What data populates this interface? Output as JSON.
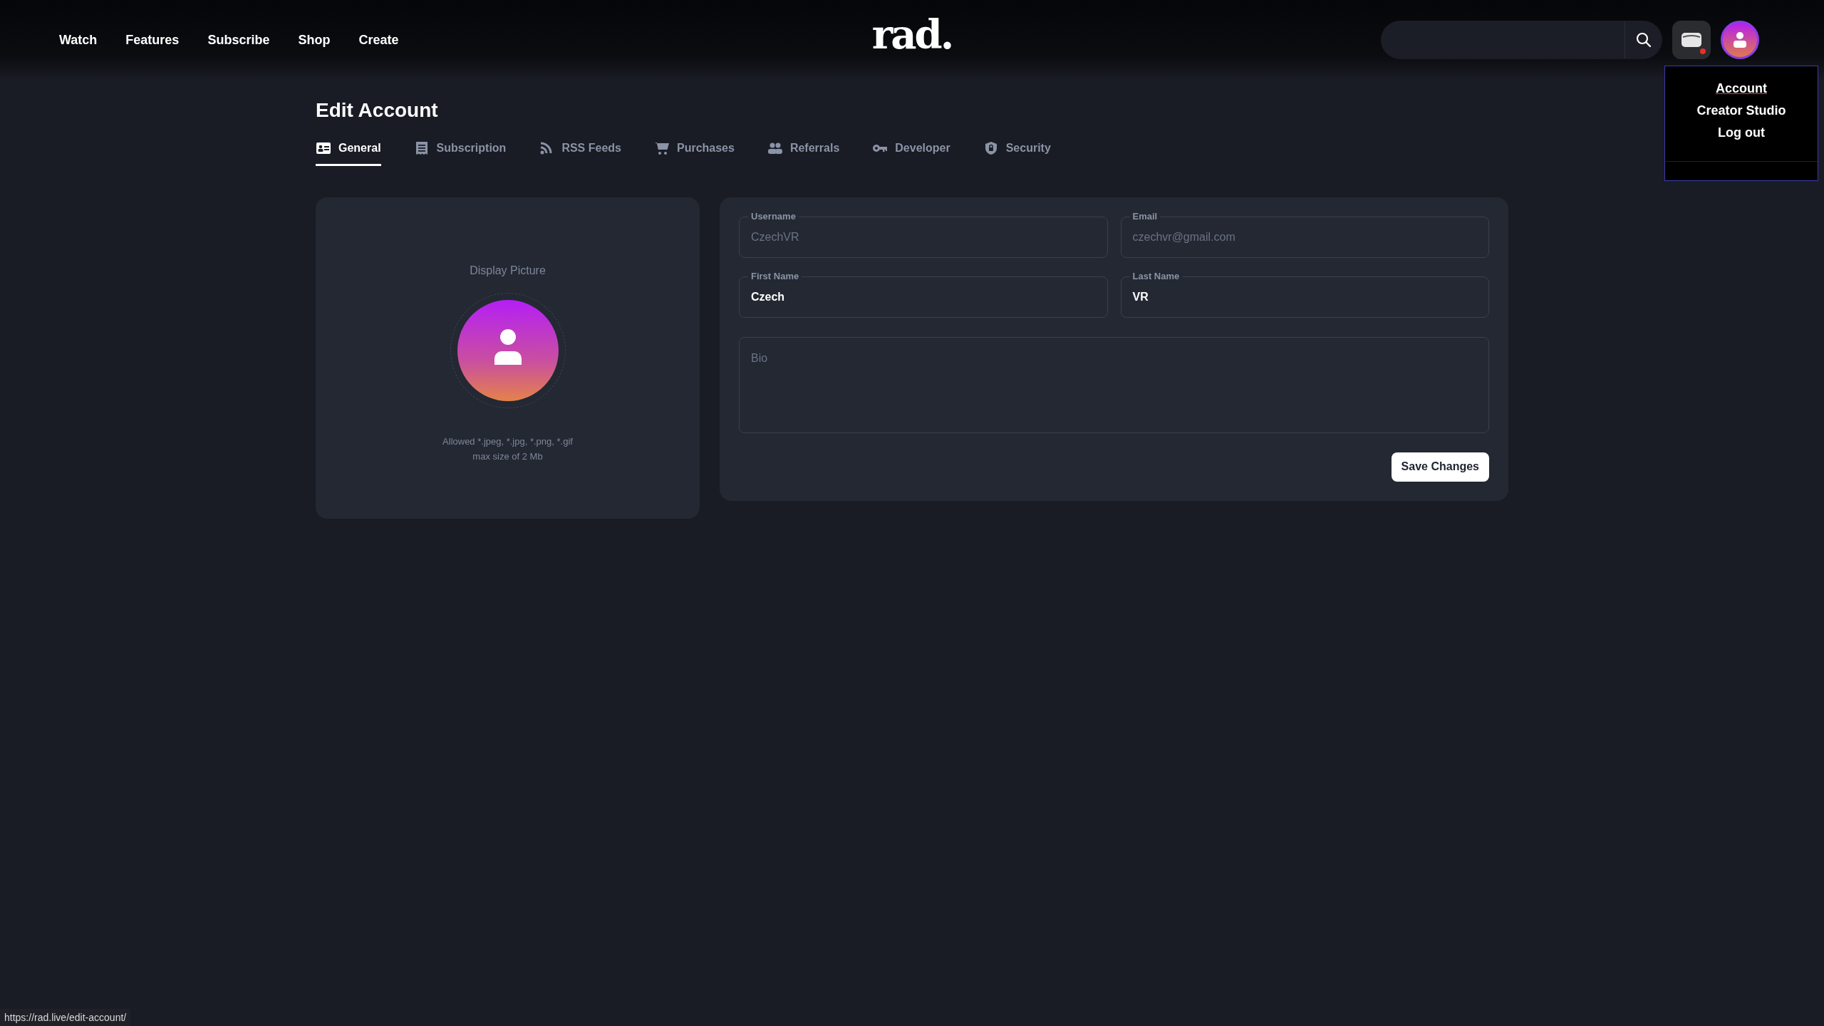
{
  "nav": {
    "links": [
      "Watch",
      "Features",
      "Subscribe",
      "Shop",
      "Create"
    ],
    "logo": "rad."
  },
  "header_actions": {
    "notification_dot": true
  },
  "account_menu": {
    "items": [
      {
        "label": "Account",
        "hovered": true
      },
      {
        "label": "Creator Studio",
        "hovered": false
      },
      {
        "label": "Log out",
        "hovered": false
      }
    ]
  },
  "page": {
    "title": "Edit Account"
  },
  "tabs": [
    {
      "label": "General",
      "kind": "idcard",
      "selected": true
    },
    {
      "label": "Subscription",
      "kind": "receipt",
      "selected": false
    },
    {
      "label": "RSS Feeds",
      "kind": "rss",
      "selected": false
    },
    {
      "label": "Purchases",
      "kind": "cart",
      "selected": false
    },
    {
      "label": "Referrals",
      "kind": "users",
      "selected": false
    },
    {
      "label": "Developer",
      "kind": "key",
      "selected": false
    },
    {
      "label": "Security",
      "kind": "shield",
      "selected": false
    }
  ],
  "display_picture": {
    "title": "Display Picture",
    "hint_lines": [
      "Allowed *.jpeg, *.jpg, *.png, *.gif",
      "max size of 2 Mb"
    ]
  },
  "form": {
    "fields": [
      {
        "label": "Username",
        "value": "CzechVR",
        "disabled": true
      },
      {
        "label": "Email",
        "value": "czechvr@gmail.com",
        "disabled": true
      },
      {
        "label": "First Name",
        "value": "Czech",
        "disabled": false
      },
      {
        "label": "Last Name",
        "value": "VR",
        "disabled": false
      }
    ],
    "bio": {
      "placeholder": "Bio"
    },
    "save_button": "Save Changes"
  },
  "status_bar": {
    "url": "https://rad.live/edit-account/"
  }
}
